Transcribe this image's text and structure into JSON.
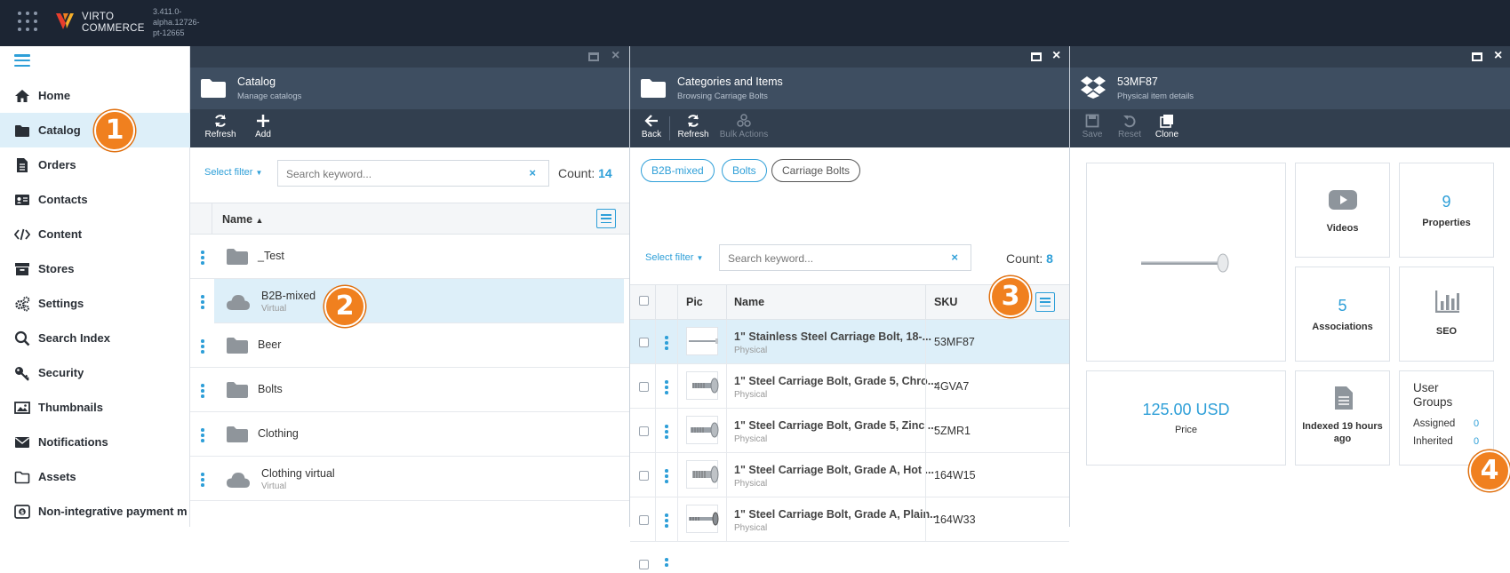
{
  "app": {
    "brand_line1": "VIRTO",
    "brand_line2": "COMMERCE",
    "version": "3.411.0-alpha.12726-pt-12665"
  },
  "sidebar": {
    "items": [
      {
        "label": "Home",
        "icon": "home-icon"
      },
      {
        "label": "Catalog",
        "icon": "folder-icon",
        "active": true
      },
      {
        "label": "Orders",
        "icon": "document-icon"
      },
      {
        "label": "Contacts",
        "icon": "id-card-icon"
      },
      {
        "label": "Content",
        "icon": "code-icon"
      },
      {
        "label": "Stores",
        "icon": "archive-icon"
      },
      {
        "label": "Settings",
        "icon": "gears-icon"
      },
      {
        "label": "Search Index",
        "icon": "search-icon"
      },
      {
        "label": "Security",
        "icon": "key-icon"
      },
      {
        "label": "Thumbnails",
        "icon": "image-icon"
      },
      {
        "label": "Notifications",
        "icon": "envelope-icon"
      },
      {
        "label": "Assets",
        "icon": "folder-outline-icon"
      },
      {
        "label": "Non-integrative payment m",
        "icon": "dollar-icon"
      }
    ]
  },
  "blade_catalog": {
    "title": "Catalog",
    "subtitle": "Manage catalogs",
    "toolbar": {
      "refresh": "Refresh",
      "add": "Add"
    },
    "select_filter": "Select filter",
    "search_placeholder": "Search keyword...",
    "count_label": "Count:",
    "count": "14",
    "col_name": "Name",
    "rows": [
      {
        "name": "_Test",
        "sub": "",
        "type": "folder"
      },
      {
        "name": "B2B-mixed",
        "sub": "Virtual",
        "type": "cloud"
      },
      {
        "name": "Beer",
        "sub": "",
        "type": "folder"
      },
      {
        "name": "Bolts",
        "sub": "",
        "type": "folder"
      },
      {
        "name": "Clothing",
        "sub": "",
        "type": "folder"
      },
      {
        "name": "Clothing virtual",
        "sub": "Virtual",
        "type": "cloud"
      }
    ]
  },
  "blade_items": {
    "title": "Categories and Items",
    "subtitle": "Browsing Carriage Bolts",
    "toolbar": {
      "back": "Back",
      "refresh": "Refresh",
      "bulk": "Bulk Actions"
    },
    "breadcrumbs": [
      "B2B-mixed",
      "Bolts",
      "Carriage Bolts"
    ],
    "select_filter": "Select filter",
    "search_placeholder": "Search keyword...",
    "count_label": "Count:",
    "count": "8",
    "cols": {
      "pic": "Pic",
      "name": "Name",
      "sku": "SKU"
    },
    "rows": [
      {
        "name": "1\" Stainless Steel Carriage Bolt, 18-...",
        "sub": "Physical",
        "sku": "53MF87"
      },
      {
        "name": "1\" Steel Carriage Bolt, Grade 5, Chro...",
        "sub": "Physical",
        "sku": "4GVA7"
      },
      {
        "name": "1\" Steel Carriage Bolt, Grade 5, Zinc ...",
        "sub": "Physical",
        "sku": "5ZMR1"
      },
      {
        "name": "1\" Steel Carriage Bolt, Grade A, Hot ...",
        "sub": "Physical",
        "sku": "164W15"
      },
      {
        "name": "1\" Steel Carriage Bolt, Grade A, Plain...",
        "sub": "Physical",
        "sku": "164W33"
      }
    ]
  },
  "blade_detail": {
    "title": "53MF87",
    "subtitle": "Physical item details",
    "toolbar": {
      "save": "Save",
      "reset": "Reset",
      "clone": "Clone"
    },
    "videos_label": "Videos",
    "properties_count": "9",
    "properties_label": "Properties",
    "associations_count": "5",
    "associations_label": "Associations",
    "seo_label": "SEO",
    "price": "125.00 USD",
    "price_label": "Price",
    "indexed_label": "Indexed 19 hours ago",
    "user_groups_title": "User Groups",
    "assigned_label": "Assigned",
    "assigned_value": "0",
    "inherited_label": "Inherited",
    "inherited_value": "0"
  },
  "badges": [
    "1",
    "2",
    "3",
    "4"
  ],
  "colors": {
    "accent": "#2e9fd8",
    "topbar": "#1c2533",
    "blade_header": "#3e4e61",
    "badge": "#f0801f"
  }
}
